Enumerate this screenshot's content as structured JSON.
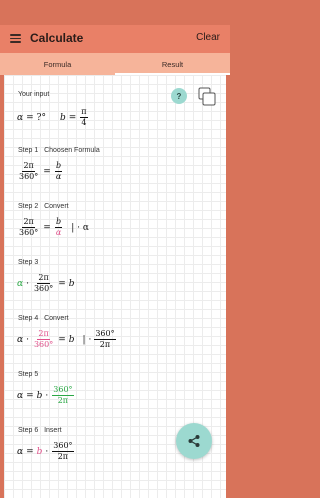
{
  "appbar": {
    "title": "Calculate",
    "clear_label": "Clear"
  },
  "tabs": [
    {
      "label": "Formula"
    },
    {
      "label": "Result"
    }
  ],
  "help": {
    "label": "?"
  },
  "input": {
    "heading": "Your input",
    "alpha_sym": "α",
    "alpha_value": "?°",
    "b_sym": "b",
    "b_num": "π",
    "b_den": "4"
  },
  "steps": [
    {
      "number": "Step 1",
      "title": "Choosen Formula"
    },
    {
      "number": "Step 2",
      "title": "Convert"
    },
    {
      "number": "Step 3",
      "title": ""
    },
    {
      "number": "Step 4",
      "title": "Convert"
    },
    {
      "number": "Step 5",
      "title": ""
    },
    {
      "number": "Step 6",
      "title": "Insert"
    }
  ],
  "math": {
    "two_pi": "2π",
    "deg360": "360°",
    "b": "b",
    "alpha": "α",
    "eq": "=",
    "dot": "·",
    "mult_alpha": "| · α",
    "mult_frac": "| ·"
  },
  "colors": {
    "pink": "#e0508a",
    "green": "#2aa845",
    "accent": "#e98067",
    "fab": "#9cd9d0"
  },
  "icons": {
    "menu": "menu-icon",
    "copy": "copy-icon",
    "share": "share-icon",
    "help": "help-icon"
  }
}
